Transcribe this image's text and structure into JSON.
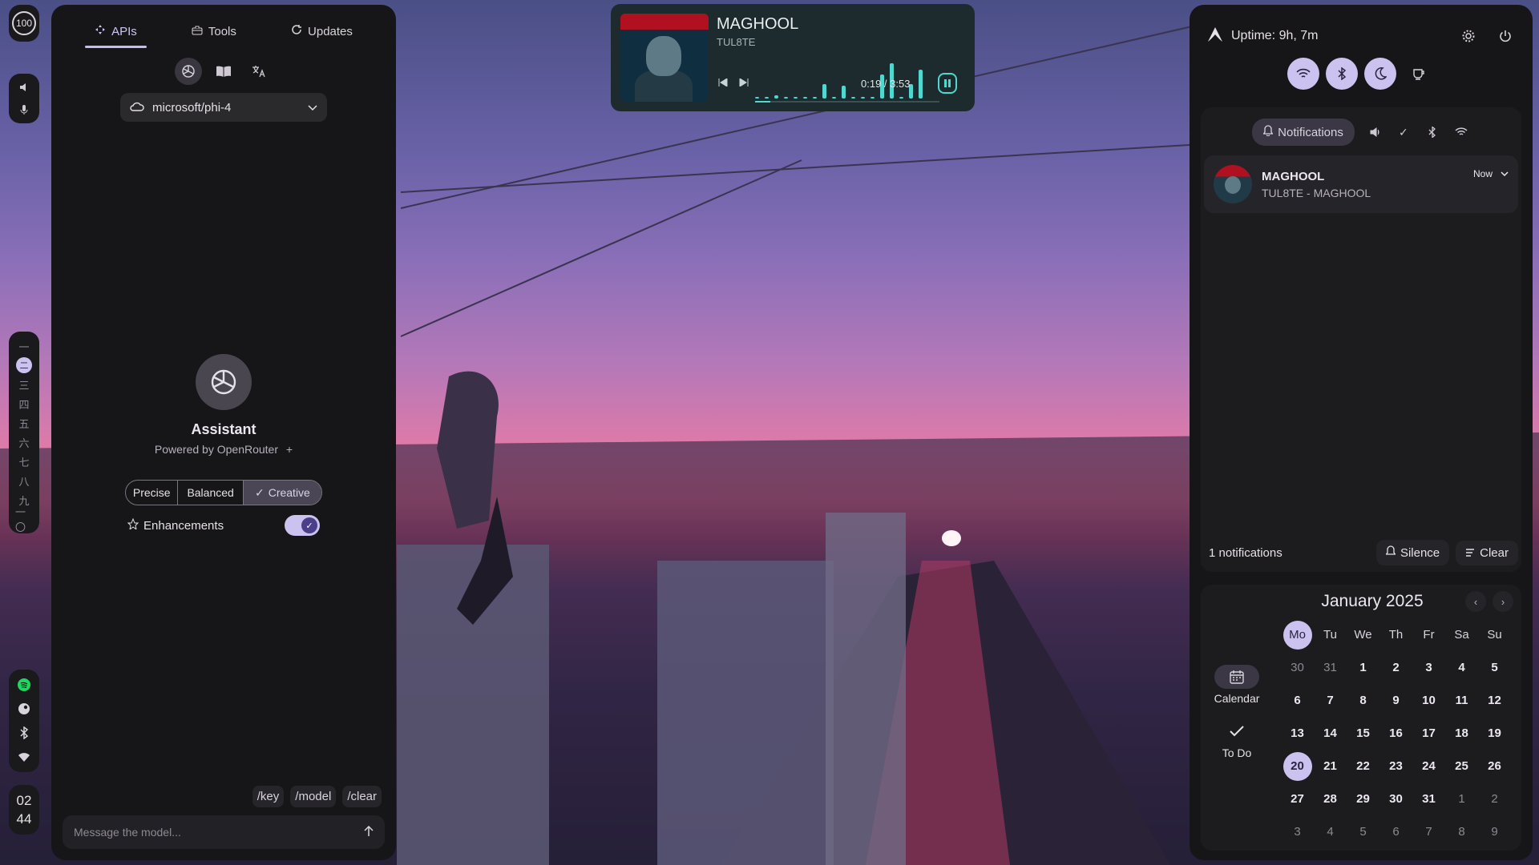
{
  "left_bar": {
    "battery": "100",
    "workspaces": [
      "一",
      "二",
      "三",
      "四",
      "五",
      "六",
      "七",
      "八",
      "九",
      "一〇"
    ],
    "active_workspace_index": 1,
    "clock_hour": "02",
    "clock_minute": "44",
    "tray_icons": [
      "spotify-icon",
      "steam-icon",
      "bluetooth-icon",
      "wifi-icon"
    ]
  },
  "sidebar_left": {
    "tabs": [
      {
        "label": "APIs",
        "icon": "api-icon"
      },
      {
        "label": "Tools",
        "icon": "toolbox-icon"
      },
      {
        "label": "Updates",
        "icon": "refresh-icon"
      }
    ],
    "active_tab": "APIs",
    "model": "microsoft/phi-4",
    "assistant_name": "Assistant",
    "powered_by": "Powered by OpenRouter",
    "modes": [
      "Precise",
      "Balanced",
      "Creative"
    ],
    "active_mode": "Creative",
    "enhancements_label": "Enhancements",
    "enhancements_on": true,
    "commands": [
      "/key",
      "/model",
      "/clear"
    ],
    "message_placeholder": "Message the model..."
  },
  "player": {
    "title": "MAGHOOL",
    "artist": "TUL8TE",
    "time": "0:19 / 3:53",
    "progress": 0.081
  },
  "sidebar_right": {
    "uptime": "Uptime: 9h, 7m",
    "notifications_tab": "Notifications",
    "notification": {
      "title": "MAGHOOL",
      "body": "TUL8TE - MAGHOOL",
      "time": "Now"
    },
    "count": "1 notifications",
    "silence": "Silence",
    "clear": "Clear",
    "calendar_label": "Calendar",
    "todo_label": "To Do",
    "month": "January 2025",
    "weekdays": [
      "Mo",
      "Tu",
      "We",
      "Th",
      "Fr",
      "Sa",
      "Su"
    ],
    "days": [
      [
        "30",
        "31",
        "1",
        "2",
        "3",
        "4",
        "5"
      ],
      [
        "6",
        "7",
        "8",
        "9",
        "10",
        "11",
        "12"
      ],
      [
        "13",
        "14",
        "15",
        "16",
        "17",
        "18",
        "19"
      ],
      [
        "20",
        "21",
        "22",
        "23",
        "24",
        "25",
        "26"
      ],
      [
        "27",
        "28",
        "29",
        "30",
        "31",
        "1",
        "2"
      ],
      [
        "3",
        "4",
        "5",
        "6",
        "7",
        "8",
        "9"
      ]
    ],
    "today": "20"
  },
  "colors": {
    "accent": "#cbc2f0",
    "panel": "#161618",
    "player_bg": "#1d2a2e",
    "player_accent": "#4fd7d0"
  }
}
